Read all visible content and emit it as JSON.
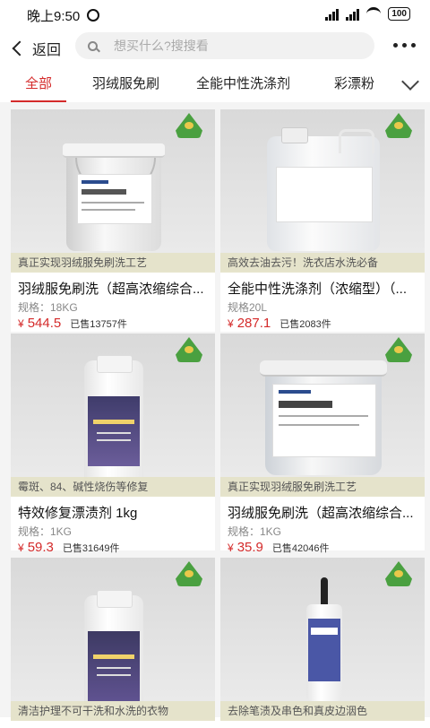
{
  "status_bar": {
    "time": "晚上9:50",
    "battery": "100"
  },
  "header": {
    "back_label": "返回",
    "search_placeholder": "想买什么?搜搜看"
  },
  "tabs": [
    {
      "label": "全部",
      "active": true
    },
    {
      "label": "羽绒服免刷",
      "active": false
    },
    {
      "label": "全能中性洗涤剂",
      "active": false
    },
    {
      "label": "彩漂粉",
      "active": false
    }
  ],
  "products": [
    {
      "caption": "真正实现羽绒服免刷洗工艺",
      "title": "羽绒服免刷洗（超高浓缩综合...",
      "spec": "规格：18KG",
      "currency": "¥",
      "price": "544.5",
      "sold": "已售13757件"
    },
    {
      "caption": "高效去油去污！洗衣店水洗必备",
      "title": "全能中性洗涤剂（浓缩型）（...",
      "spec": "规格20L",
      "currency": "¥",
      "price": "287.1",
      "sold": "已售2083件"
    },
    {
      "caption": "霉斑、84、碱性烧伤等修复",
      "title": "特效修复漂渍剂 1kg",
      "spec": "规格：1KG",
      "currency": "¥",
      "price": "59.3",
      "sold": "已售31649件"
    },
    {
      "caption": "真正实现羽绒服免刷洗工艺",
      "title": "羽绒服免刷洗（超高浓缩综合...",
      "spec": "规格：1KG",
      "currency": "¥",
      "price": "35.9",
      "sold": "已售42046件"
    },
    {
      "caption": "清洁护理不可干洗和水洗的衣物",
      "title": "",
      "spec": "",
      "currency": "",
      "price": "",
      "sold": ""
    },
    {
      "caption": "去除笔渍及串色和真皮边洇色",
      "title": "",
      "spec": "",
      "currency": "",
      "price": "",
      "sold": ""
    }
  ]
}
